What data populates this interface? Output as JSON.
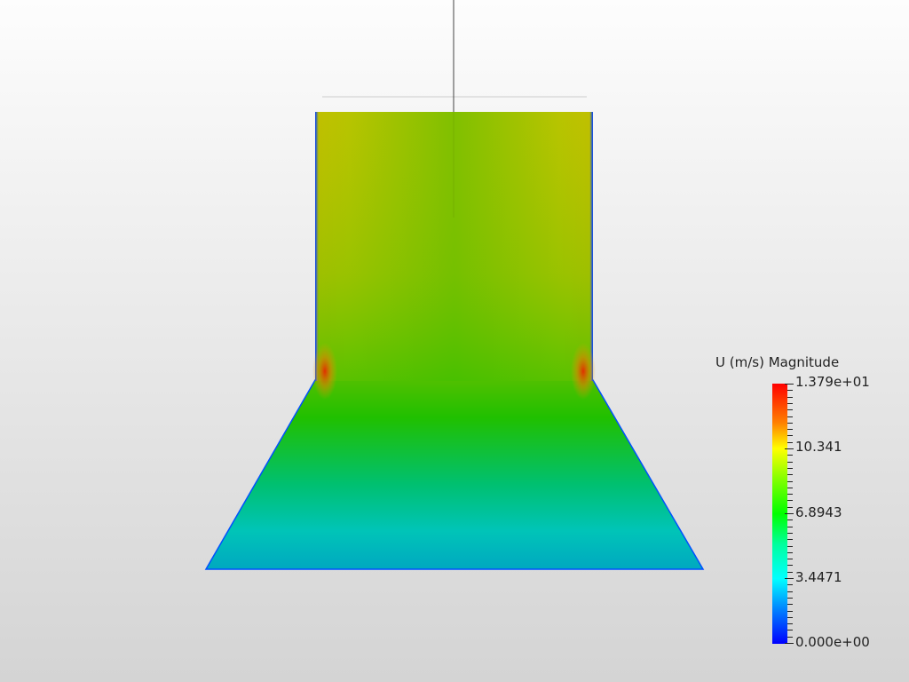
{
  "legend": {
    "title": "U (m/s) Magnitude",
    "labels": [
      "1.379e+01",
      "10.341",
      "6.8943",
      "3.4471",
      "0.000e+00"
    ],
    "range": [
      0,
      13.79
    ]
  },
  "colors": {
    "high": "#ff0000",
    "mid": "#00ff00",
    "low": "#0000ff"
  }
}
